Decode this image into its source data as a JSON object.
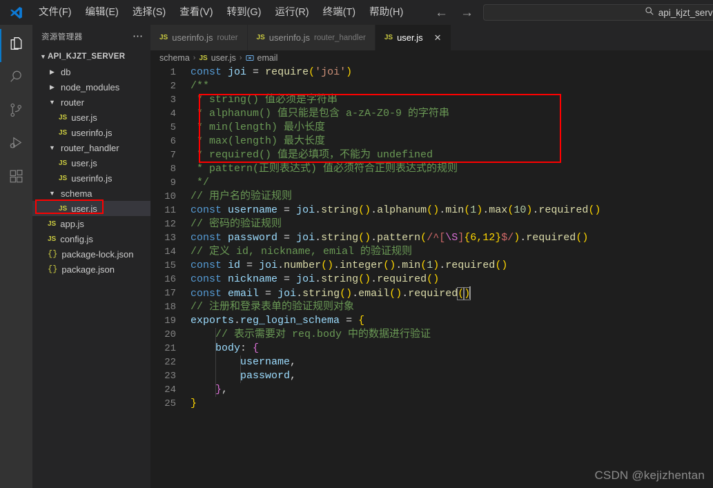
{
  "titlebar": {
    "logo_icon": "vscode-logo-icon",
    "menus": [
      {
        "label": "文件(F)"
      },
      {
        "label": "编辑(E)"
      },
      {
        "label": "选择(S)"
      },
      {
        "label": "查看(V)"
      },
      {
        "label": "转到(G)"
      },
      {
        "label": "运行(R)"
      },
      {
        "label": "终端(T)"
      },
      {
        "label": "帮助(H)"
      }
    ],
    "nav_back_icon": "arrow-left-icon",
    "nav_forward_icon": "arrow-right-icon",
    "search": {
      "icon": "search-icon",
      "value": "api_kjzt_serve",
      "placeholder": ""
    }
  },
  "activitybar": {
    "items": [
      {
        "name": "explorer",
        "icon": "files-icon",
        "active": true
      },
      {
        "name": "search",
        "icon": "search-icon",
        "active": false
      },
      {
        "name": "source-control",
        "icon": "source-control-icon",
        "active": false
      },
      {
        "name": "run-and-debug",
        "icon": "run-debug-icon",
        "active": false
      },
      {
        "name": "extensions",
        "icon": "extensions-icon",
        "active": false
      }
    ]
  },
  "sidebar": {
    "title": "资源管理器",
    "more_actions_icon": "ellipsis-icon",
    "root": {
      "label": "API_KJZT_SERVER",
      "expanded": true
    },
    "tree": [
      {
        "label": "db",
        "type": "folder",
        "indent": 1,
        "expanded": false,
        "selected": false
      },
      {
        "label": "node_modules",
        "type": "folder",
        "indent": 1,
        "expanded": false,
        "selected": false
      },
      {
        "label": "router",
        "type": "folder",
        "indent": 1,
        "expanded": true,
        "selected": false
      },
      {
        "label": "user.js",
        "type": "js",
        "indent": 2,
        "selected": false
      },
      {
        "label": "userinfo.js",
        "type": "js",
        "indent": 2,
        "selected": false
      },
      {
        "label": "router_handler",
        "type": "folder",
        "indent": 1,
        "expanded": true,
        "selected": false
      },
      {
        "label": "user.js",
        "type": "js",
        "indent": 2,
        "selected": false
      },
      {
        "label": "userinfo.js",
        "type": "js",
        "indent": 2,
        "selected": false
      },
      {
        "label": "schema",
        "type": "folder",
        "indent": 1,
        "expanded": true,
        "selected": false
      },
      {
        "label": "user.js",
        "type": "js",
        "indent": 2,
        "selected": true
      },
      {
        "label": "app.js",
        "type": "js",
        "indent": 1,
        "selected": false
      },
      {
        "label": "config.js",
        "type": "js",
        "indent": 1,
        "selected": false
      },
      {
        "label": "package-lock.json",
        "type": "json",
        "indent": 1,
        "selected": false
      },
      {
        "label": "package.json",
        "type": "json",
        "indent": 1,
        "selected": false
      }
    ]
  },
  "editor": {
    "tabs": [
      {
        "name": "userinfo.js",
        "dir": "router",
        "icon": "js-file-icon",
        "active": false,
        "closable": false
      },
      {
        "name": "userinfo.js",
        "dir": "router_handler",
        "icon": "js-file-icon",
        "active": false,
        "closable": false
      },
      {
        "name": "user.js",
        "dir": "",
        "icon": "js-file-icon",
        "active": true,
        "closable": true,
        "close_icon": "close-icon"
      }
    ],
    "breadcrumb": [
      {
        "label": "schema",
        "icon": ""
      },
      {
        "label": "user.js",
        "icon": "js-file-icon"
      },
      {
        "label": "email",
        "icon": "symbol-variable-icon"
      }
    ],
    "breadcrumb_separator": "›",
    "code": [
      {
        "n": 1,
        "tokens": [
          {
            "t": "const",
            "c": "kw"
          },
          {
            "t": " ",
            "c": "op"
          },
          {
            "t": "joi",
            "c": "var"
          },
          {
            "t": " = ",
            "c": "op"
          },
          {
            "t": "require",
            "c": "fn"
          },
          {
            "t": "(",
            "c": "par1"
          },
          {
            "t": "'joi'",
            "c": "str"
          },
          {
            "t": ")",
            "c": "par1"
          }
        ]
      },
      {
        "n": 2,
        "tokens": [
          {
            "t": "/**",
            "c": "cmt"
          }
        ]
      },
      {
        "n": 3,
        "tokens": [
          {
            "t": " * string() 值必须是字符串",
            "c": "cmt"
          }
        ]
      },
      {
        "n": 4,
        "tokens": [
          {
            "t": " * alphanum() 值只能是包含 a-zA-Z0-9 的字符串",
            "c": "cmt"
          }
        ]
      },
      {
        "n": 5,
        "tokens": [
          {
            "t": " * min(length) 最小长度",
            "c": "cmt"
          }
        ]
      },
      {
        "n": 6,
        "tokens": [
          {
            "t": " * max(length) 最大长度",
            "c": "cmt"
          }
        ]
      },
      {
        "n": 7,
        "tokens": [
          {
            "t": " * required() 值是必填项，不能为 undefined",
            "c": "cmt"
          }
        ]
      },
      {
        "n": 8,
        "tokens": [
          {
            "t": " * pattern(正则表达式) 值必须符合正则表达式的规则",
            "c": "cmt"
          }
        ]
      },
      {
        "n": 9,
        "tokens": [
          {
            "t": " */",
            "c": "cmt"
          }
        ]
      },
      {
        "n": 10,
        "tokens": [
          {
            "t": "// 用户名的验证规则",
            "c": "cmt"
          }
        ]
      },
      {
        "n": 11,
        "tokens": [
          {
            "t": "const",
            "c": "kw"
          },
          {
            "t": " ",
            "c": "op"
          },
          {
            "t": "username",
            "c": "var"
          },
          {
            "t": " = ",
            "c": "op"
          },
          {
            "t": "joi",
            "c": "var"
          },
          {
            "t": ".",
            "c": "op"
          },
          {
            "t": "string",
            "c": "fn"
          },
          {
            "t": "(",
            "c": "par1"
          },
          {
            "t": ")",
            "c": "par1"
          },
          {
            "t": ".",
            "c": "op"
          },
          {
            "t": "alphanum",
            "c": "fn"
          },
          {
            "t": "(",
            "c": "par1"
          },
          {
            "t": ")",
            "c": "par1"
          },
          {
            "t": ".",
            "c": "op"
          },
          {
            "t": "min",
            "c": "fn"
          },
          {
            "t": "(",
            "c": "par1"
          },
          {
            "t": "1",
            "c": "num"
          },
          {
            "t": ")",
            "c": "par1"
          },
          {
            "t": ".",
            "c": "op"
          },
          {
            "t": "max",
            "c": "fn"
          },
          {
            "t": "(",
            "c": "par1"
          },
          {
            "t": "10",
            "c": "num"
          },
          {
            "t": ")",
            "c": "par1"
          },
          {
            "t": ".",
            "c": "op"
          },
          {
            "t": "required",
            "c": "fn"
          },
          {
            "t": "(",
            "c": "par1"
          },
          {
            "t": ")",
            "c": "par1"
          }
        ]
      },
      {
        "n": 12,
        "tokens": [
          {
            "t": "// 密码的验证规则",
            "c": "cmt"
          }
        ]
      },
      {
        "n": 13,
        "tokens": [
          {
            "t": "const",
            "c": "kw"
          },
          {
            "t": " ",
            "c": "op"
          },
          {
            "t": "password",
            "c": "var"
          },
          {
            "t": " = ",
            "c": "op"
          },
          {
            "t": "joi",
            "c": "var"
          },
          {
            "t": ".",
            "c": "op"
          },
          {
            "t": "string",
            "c": "fn"
          },
          {
            "t": "(",
            "c": "par1"
          },
          {
            "t": ")",
            "c": "par1"
          },
          {
            "t": ".",
            "c": "op"
          },
          {
            "t": "pattern",
            "c": "fn"
          },
          {
            "t": "(",
            "c": "par1"
          },
          {
            "t": "/^[",
            "c": "rgx"
          },
          {
            "t": "\\S",
            "c": "par2"
          },
          {
            "t": "]",
            "c": "rgx"
          },
          {
            "t": "{6,12}",
            "c": "par1"
          },
          {
            "t": "$/",
            "c": "rgx"
          },
          {
            "t": ")",
            "c": "par1"
          },
          {
            "t": ".",
            "c": "op"
          },
          {
            "t": "required",
            "c": "fn"
          },
          {
            "t": "(",
            "c": "par1"
          },
          {
            "t": ")",
            "c": "par1"
          }
        ]
      },
      {
        "n": 14,
        "tokens": [
          {
            "t": "// 定义 id, nickname, emial 的验证规则",
            "c": "cmt"
          }
        ]
      },
      {
        "n": 15,
        "tokens": [
          {
            "t": "const",
            "c": "kw"
          },
          {
            "t": " ",
            "c": "op"
          },
          {
            "t": "id",
            "c": "var"
          },
          {
            "t": " = ",
            "c": "op"
          },
          {
            "t": "joi",
            "c": "var"
          },
          {
            "t": ".",
            "c": "op"
          },
          {
            "t": "number",
            "c": "fn"
          },
          {
            "t": "(",
            "c": "par1"
          },
          {
            "t": ")",
            "c": "par1"
          },
          {
            "t": ".",
            "c": "op"
          },
          {
            "t": "integer",
            "c": "fn"
          },
          {
            "t": "(",
            "c": "par1"
          },
          {
            "t": ")",
            "c": "par1"
          },
          {
            "t": ".",
            "c": "op"
          },
          {
            "t": "min",
            "c": "fn"
          },
          {
            "t": "(",
            "c": "par1"
          },
          {
            "t": "1",
            "c": "num"
          },
          {
            "t": ")",
            "c": "par1"
          },
          {
            "t": ".",
            "c": "op"
          },
          {
            "t": "required",
            "c": "fn"
          },
          {
            "t": "(",
            "c": "par1"
          },
          {
            "t": ")",
            "c": "par1"
          }
        ]
      },
      {
        "n": 16,
        "tokens": [
          {
            "t": "const",
            "c": "kw"
          },
          {
            "t": " ",
            "c": "op"
          },
          {
            "t": "nickname",
            "c": "var"
          },
          {
            "t": " = ",
            "c": "op"
          },
          {
            "t": "joi",
            "c": "var"
          },
          {
            "t": ".",
            "c": "op"
          },
          {
            "t": "string",
            "c": "fn"
          },
          {
            "t": "(",
            "c": "par1"
          },
          {
            "t": ")",
            "c": "par1"
          },
          {
            "t": ".",
            "c": "op"
          },
          {
            "t": "required",
            "c": "fn"
          },
          {
            "t": "(",
            "c": "par1"
          },
          {
            "t": ")",
            "c": "par1"
          }
        ]
      },
      {
        "n": 17,
        "tokens": [
          {
            "t": "const",
            "c": "kw"
          },
          {
            "t": " ",
            "c": "op"
          },
          {
            "t": "email",
            "c": "var"
          },
          {
            "t": " = ",
            "c": "op"
          },
          {
            "t": "joi",
            "c": "var"
          },
          {
            "t": ".",
            "c": "op"
          },
          {
            "t": "string",
            "c": "fn"
          },
          {
            "t": "(",
            "c": "par1"
          },
          {
            "t": ")",
            "c": "par1"
          },
          {
            "t": ".",
            "c": "op"
          },
          {
            "t": "email",
            "c": "fn"
          },
          {
            "t": "(",
            "c": "par1"
          },
          {
            "t": ")",
            "c": "par1"
          },
          {
            "t": ".",
            "c": "op"
          },
          {
            "t": "required",
            "c": "fn"
          },
          {
            "t": "(",
            "c": "par1 brkmatch"
          },
          {
            "t": ")",
            "c": "par1 brkmatch"
          }
        ],
        "cursor": true
      },
      {
        "n": 18,
        "tokens": [
          {
            "t": "// 注册和登录表单的验证规则对象",
            "c": "cmt"
          }
        ]
      },
      {
        "n": 19,
        "tokens": [
          {
            "t": "exports",
            "c": "var"
          },
          {
            "t": ".",
            "c": "op"
          },
          {
            "t": "reg_login_schema",
            "c": "var"
          },
          {
            "t": " = ",
            "c": "op"
          },
          {
            "t": "{",
            "c": "par1"
          }
        ]
      },
      {
        "n": 20,
        "tokens": [
          {
            "t": "    // 表示需要对 req.body 中的数据进行验证",
            "c": "cmt"
          }
        ],
        "guides": [
          1
        ]
      },
      {
        "n": 21,
        "tokens": [
          {
            "t": "    ",
            "c": "op"
          },
          {
            "t": "body",
            "c": "var"
          },
          {
            "t": ": ",
            "c": "op"
          },
          {
            "t": "{",
            "c": "par2"
          }
        ],
        "guides": [
          1
        ]
      },
      {
        "n": 22,
        "tokens": [
          {
            "t": "        ",
            "c": "op"
          },
          {
            "t": "username",
            "c": "var"
          },
          {
            "t": ",",
            "c": "op"
          }
        ],
        "guides": [
          1,
          2
        ]
      },
      {
        "n": 23,
        "tokens": [
          {
            "t": "        ",
            "c": "op"
          },
          {
            "t": "password",
            "c": "var"
          },
          {
            "t": ",",
            "c": "op"
          }
        ],
        "guides": [
          1,
          2
        ]
      },
      {
        "n": 24,
        "tokens": [
          {
            "t": "    ",
            "c": "op"
          },
          {
            "t": "}",
            "c": "par2"
          },
          {
            "t": ",",
            "c": "op"
          }
        ],
        "guides": [
          1
        ]
      },
      {
        "n": 25,
        "tokens": [
          {
            "t": "}",
            "c": "par1"
          }
        ]
      }
    ]
  },
  "annotations": {
    "code_box_color": "#ff0000",
    "sidebar_box_color": "#ff0000"
  },
  "watermark": "CSDN @kejizhentan"
}
